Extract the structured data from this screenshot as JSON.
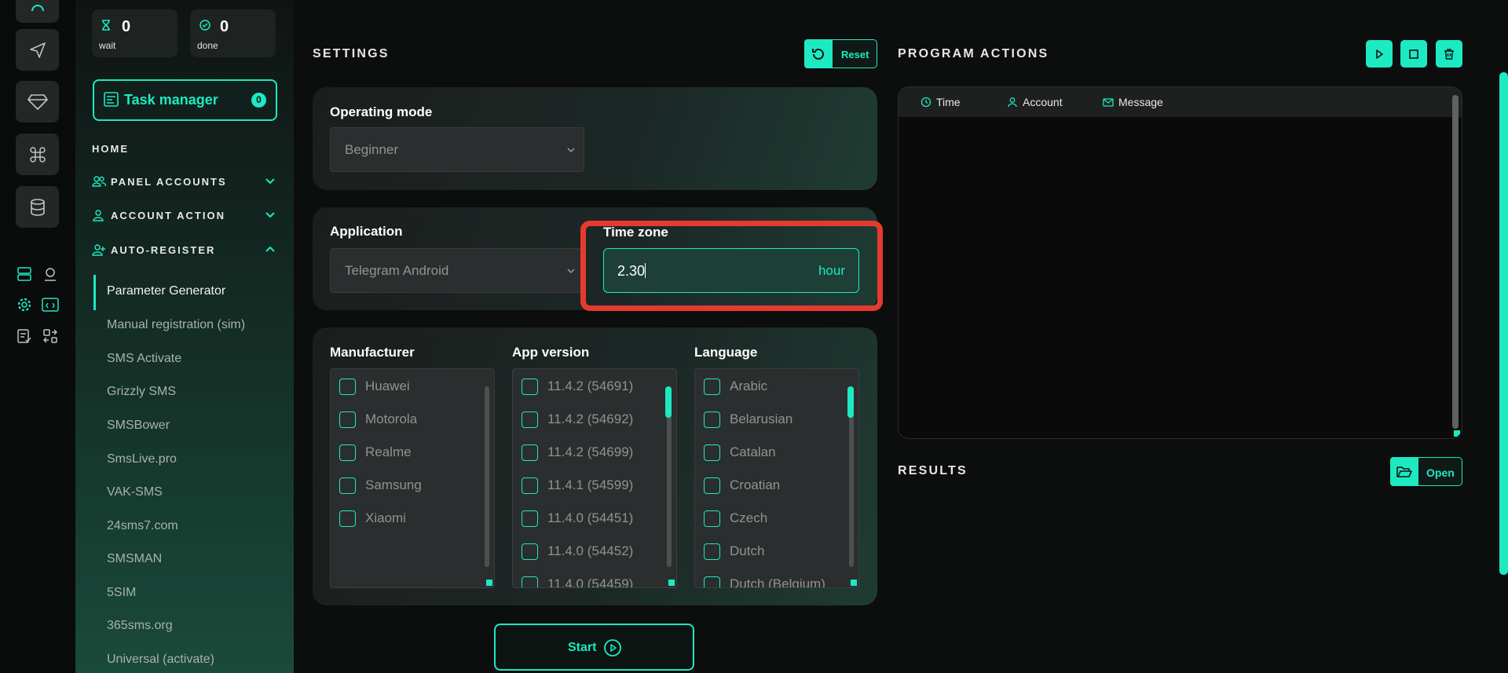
{
  "stats": {
    "wait": {
      "value": "0",
      "label": "wait"
    },
    "done": {
      "value": "0",
      "label": "done"
    }
  },
  "task_manager": {
    "label": "Task manager",
    "count": "0"
  },
  "nav": {
    "home": "HOME",
    "sections": [
      {
        "label": "PANEL ACCOUNTS",
        "expanded": false
      },
      {
        "label": "ACCOUNT ACTION",
        "expanded": false
      },
      {
        "label": "AUTO-REGISTER",
        "expanded": true
      }
    ],
    "auto_register_items": [
      "Parameter Generator",
      "Manual registration (sim)",
      "SMS Activate",
      "Grizzly SMS",
      "SMSBower",
      "SmsLive.pro",
      "VAK-SMS",
      "24sms7.com",
      "SMSMAN",
      "5SIM",
      "365sms.org",
      "Universal (activate)"
    ],
    "active_item": "Parameter Generator"
  },
  "settings": {
    "title": "SETTINGS",
    "reset_label": "Reset",
    "operating_mode": {
      "label": "Operating mode",
      "value": "Beginner"
    },
    "application": {
      "label": "Application",
      "value": "Telegram Android"
    },
    "time_zone": {
      "label": "Time zone",
      "value": "2.30",
      "unit": "hour"
    },
    "manufacturer": {
      "label": "Manufacturer",
      "options": [
        "Huawei",
        "Motorola",
        "Realme",
        "Samsung",
        "Xiaomi"
      ]
    },
    "app_version": {
      "label": "App version",
      "options": [
        "11.4.2 (54691)",
        "11.4.2 (54692)",
        "11.4.2 (54699)",
        "11.4.1 (54599)",
        "11.4.0 (54451)",
        "11.4.0 (54452)",
        "11.4.0 (54459)"
      ]
    },
    "language": {
      "label": "Language",
      "options": [
        "Arabic",
        "Belarusian",
        "Catalan",
        "Croatian",
        "Czech",
        "Dutch",
        "Dutch (Belgium)"
      ]
    },
    "start_label": "Start"
  },
  "program_actions": {
    "title": "PROGRAM ACTIONS",
    "columns": [
      "Time",
      "Account",
      "Message"
    ]
  },
  "results": {
    "title": "RESULTS",
    "open_label": "Open"
  },
  "colors": {
    "accent": "#1de9c2",
    "highlight": "#e63a2e",
    "background": "#0c0d0d"
  }
}
